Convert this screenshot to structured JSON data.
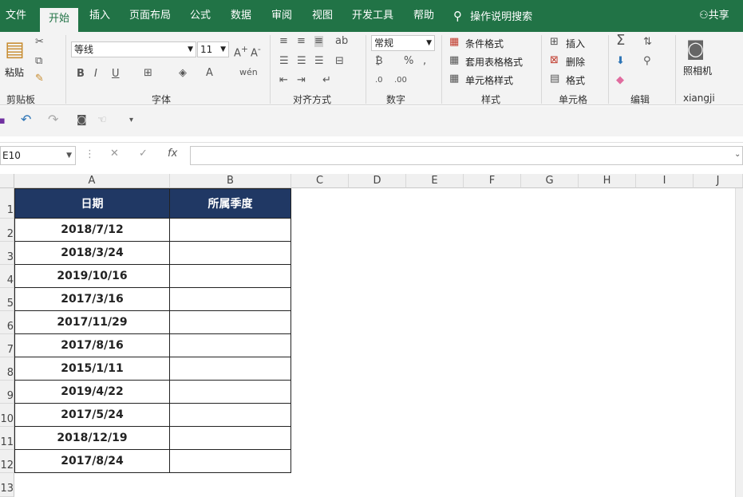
{
  "tabs": [
    {
      "label": "文件"
    },
    {
      "label": "开始"
    },
    {
      "label": "插入"
    },
    {
      "label": "页面布局"
    },
    {
      "label": "公式"
    },
    {
      "label": "数据"
    },
    {
      "label": "审阅"
    },
    {
      "label": "视图"
    },
    {
      "label": "开发工具"
    },
    {
      "label": "帮助"
    }
  ],
  "tell_me": "操作说明搜索",
  "share": "共享",
  "ribbon": {
    "paste": "粘贴",
    "font_name": "等线",
    "font_size": "11",
    "number_format": "常规",
    "cond_format": "条件格式",
    "table_format": "套用表格格式",
    "cell_style": "单元格样式",
    "insert": "插入",
    "delete": "删除",
    "format": "格式",
    "camera": "照相机",
    "groups": {
      "clipboard": "剪贴板",
      "font": "字体",
      "align": "对齐方式",
      "number": "数字",
      "styles": "样式",
      "cells": "单元格",
      "editing": "编辑",
      "addin": "xiangji"
    }
  },
  "name_box": "E10",
  "formula_value": "",
  "columns": [
    "A",
    "B",
    "C",
    "D",
    "E",
    "F",
    "G",
    "H",
    "I",
    "J"
  ],
  "rows": [
    "1",
    "2",
    "3",
    "4",
    "5",
    "6",
    "7",
    "8",
    "9",
    "10",
    "11",
    "12",
    "13"
  ],
  "table": {
    "headers": [
      "日期",
      "所属季度"
    ],
    "dates": [
      "2018/7/12",
      "2018/3/24",
      "2019/10/16",
      "2017/3/16",
      "2017/11/29",
      "2017/8/16",
      "2015/1/11",
      "2019/4/22",
      "2017/5/24",
      "2018/12/19",
      "2017/8/24"
    ]
  },
  "colors": {
    "brand": "#217346",
    "header_fill": "#203864"
  }
}
